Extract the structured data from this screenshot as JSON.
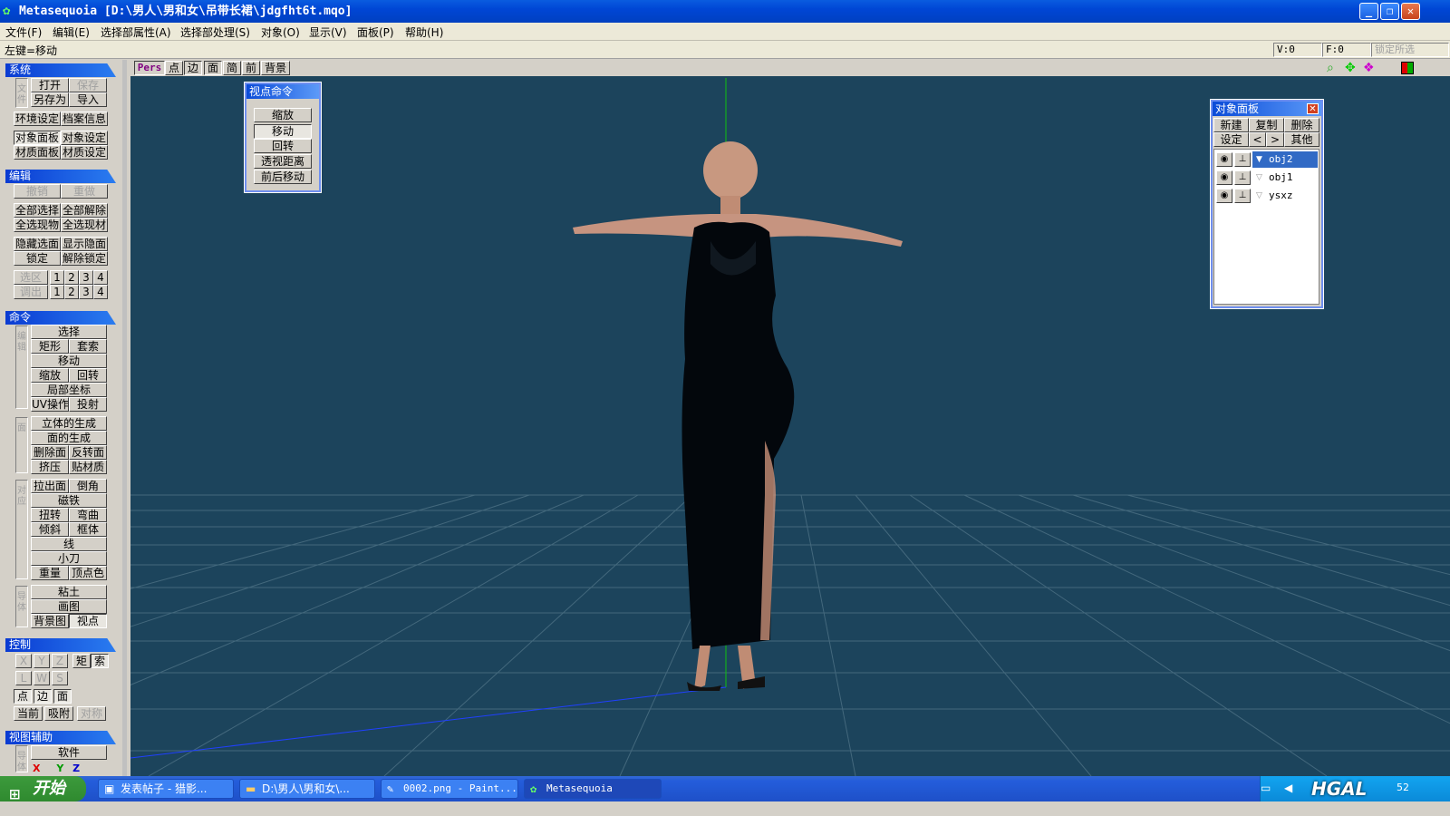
{
  "window": {
    "title": "Metasequoia [D:\\男人\\男和女\\吊带长裙\\jdgfht6t.mqo]"
  },
  "menu": [
    "文件(F)",
    "编辑(E)",
    "选择部属性(A)",
    "选择部处理(S)",
    "对象(O)",
    "显示(V)",
    "面板(P)",
    "帮助(H)"
  ],
  "status": {
    "hint": "左键=移动",
    "vertex": "V:0",
    "faces": "F:0",
    "lock": "锁定所选"
  },
  "left": {
    "system": {
      "title": "系统",
      "open": "打开",
      "save": "保存",
      "saveas": "另存为",
      "import": "导入",
      "env": "环境设定",
      "docinfo": "档案信息",
      "objpanel": "对象面板",
      "objset": "对象设定",
      "matpanel": "材质面板",
      "matset": "材质设定",
      "side": "文件"
    },
    "edit": {
      "title": "编辑",
      "undo": "撤销",
      "redo": "重做",
      "selall": "全部选择",
      "deselall": "全部解除",
      "selobj": "全选现物",
      "selmat": "全选现材",
      "hidesel": "隐藏选面",
      "showhide": "显示隐面",
      "lock": "锁定",
      "unlock": "解除锁定",
      "selarea": "选区",
      "callout": "调出",
      "n1": "1",
      "n2": "2",
      "n3": "3",
      "n4": "4"
    },
    "command": {
      "title": "命令",
      "select": "选择",
      "rect": "矩形",
      "lasso": "套索",
      "move": "移动",
      "scale": "缩放",
      "rotate": "回转",
      "localcoord": "局部坐标",
      "uv": "UV操作",
      "project": "投射",
      "solid": "立体的生成",
      "face": "面的生成",
      "delface": "删除面",
      "flip": "反转面",
      "extrude": "挤压",
      "mapping": "贴材质",
      "pushout": "拉出面",
      "bevel": "倒角",
      "magnet": "磁铁",
      "twist": "扭转",
      "bend": "弯曲",
      "lean": "倾斜",
      "lattice": "框体",
      "line": "线",
      "knife": "小刀",
      "weight": "重量",
      "vcolor": "顶点色",
      "clay": "粘土",
      "paint": "画图",
      "bgimage": "背景图",
      "viewpoint": "视点",
      "side1": "编辑",
      "side2": "面",
      "side3": "对应",
      "side4": "导体"
    },
    "control": {
      "title": "控制",
      "x": "X",
      "y": "Y",
      "z": "Z",
      "rect": "矩",
      "lasso": "索",
      "l": "L",
      "w": "W",
      "s": "S",
      "point": "点",
      "edge": "边",
      "face": "面",
      "current": "当前",
      "snap": "吸附",
      "sym": "对称"
    },
    "viewaid": {
      "title": "视图辅助",
      "soft": "软件",
      "side": "导体"
    }
  },
  "viewtoolbar": {
    "pers": "Pers",
    "point": "点",
    "edge": "边",
    "face": "面",
    "simple": "简",
    "front": "前",
    "bg": "背景"
  },
  "viewpoint_panel": {
    "title": "视点命令",
    "zoom": "缩放",
    "move": "移动",
    "rotate": "回转",
    "persp": "透视距离",
    "dolly": "前后移动"
  },
  "object_panel": {
    "title": "对象面板",
    "new": "新建",
    "copy": "复制",
    "delete": "删除",
    "settings": "设定",
    "prev": "<",
    "next": ">",
    "other": "其他",
    "objects": [
      {
        "name": "obj2"
      },
      {
        "name": "obj1"
      },
      {
        "name": "ysxz"
      }
    ]
  },
  "taskbar": {
    "start": "开始",
    "tasks": [
      {
        "label": "发表帖子 - 猎影..."
      },
      {
        "label": "D:\\男人\\男和女\\..."
      },
      {
        "label": "0002.png - Paint..."
      },
      {
        "label": "Metasequoia"
      }
    ],
    "watermark": "HGAL",
    "clock": "52"
  },
  "colors": {
    "titlebar": "#0046d5",
    "viewport": "#1c445c",
    "accent": "#316ac5"
  }
}
